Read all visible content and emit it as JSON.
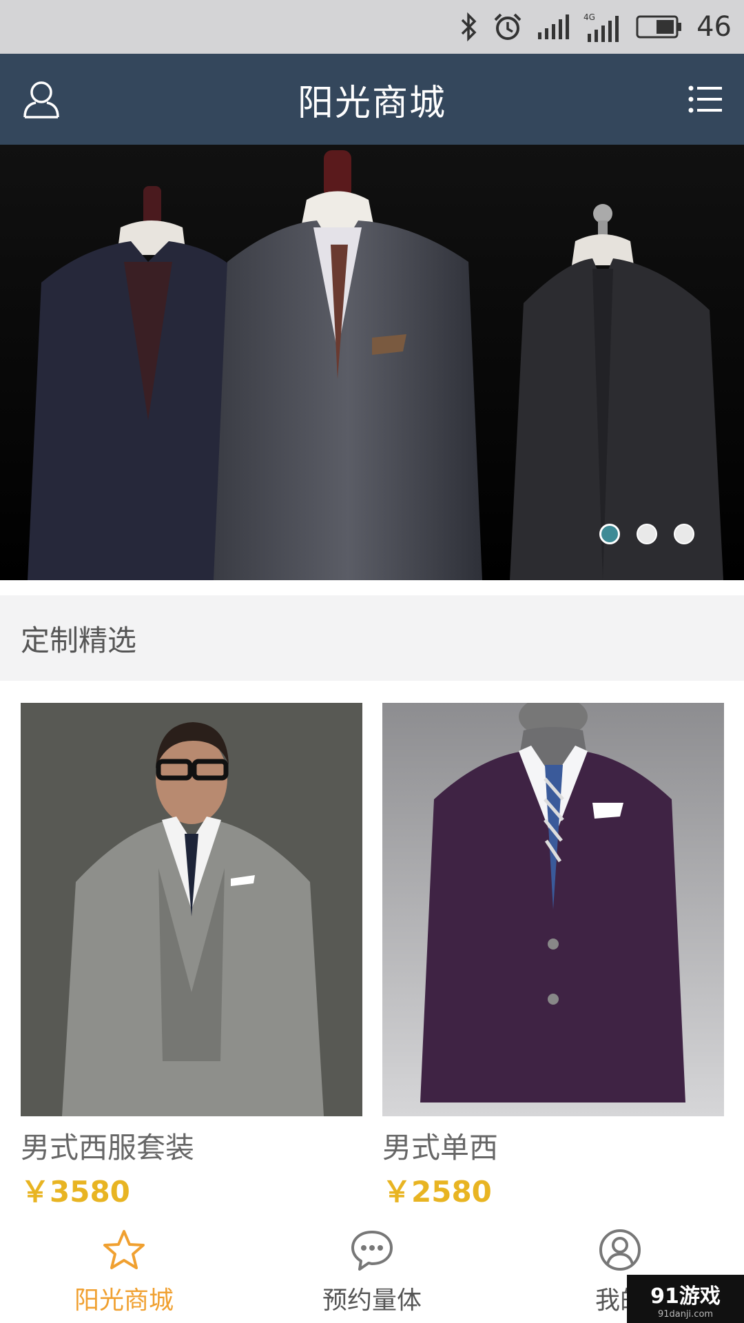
{
  "status_bar": {
    "battery": "46",
    "icons": [
      "bluetooth-icon",
      "alarm-icon",
      "signal-icon",
      "4g-signal-icon",
      "battery-icon"
    ]
  },
  "header": {
    "title": "阳光商城",
    "left_icon": "user-icon",
    "right_icon": "list-menu-icon",
    "background": "#34475c"
  },
  "banner": {
    "slide_count": 3,
    "active_index": 0,
    "active_dot_color": "#3e8b96"
  },
  "section": {
    "title": "定制精选"
  },
  "products": [
    {
      "name": "男式西服套装",
      "price": "￥3580"
    },
    {
      "name": "男式单西",
      "price": "￥2580"
    }
  ],
  "price_color": "#e8b422",
  "bottom_nav": {
    "items": [
      {
        "label": "阳光商城",
        "icon": "star-icon",
        "active": true
      },
      {
        "label": "预约量体",
        "icon": "chat-bubble-icon",
        "active": false
      },
      {
        "label": "我的",
        "icon": "profile-icon",
        "active": false
      }
    ],
    "active_color": "#f0a030"
  },
  "watermark": {
    "text": "91游戏",
    "url_text": "91danji.com"
  }
}
